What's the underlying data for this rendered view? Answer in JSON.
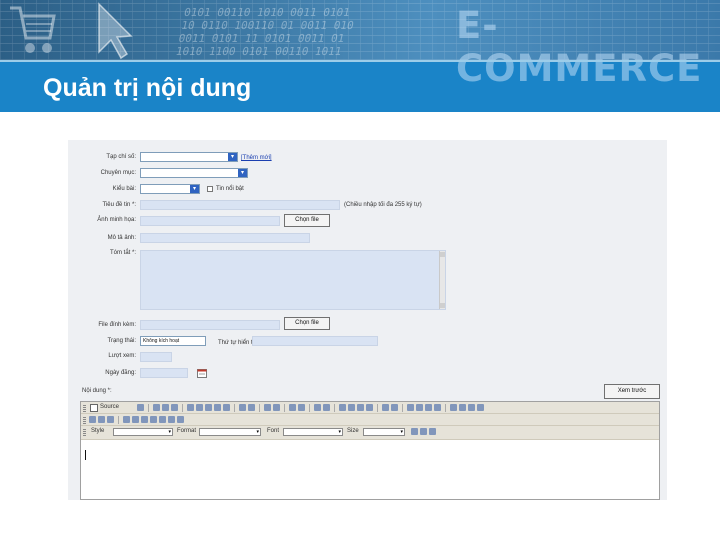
{
  "banner": {
    "brand_text": "E-COMMERCE",
    "digits": "0101 00110 1010 0011 0101\n10 0110 100110 01 0011 010\n0011 0101 11 0101 0011 01\n1010 1100 0101 00110 1011"
  },
  "slide": {
    "title": "Quản trị nội dung"
  },
  "form": {
    "labels": [
      "Tạp chí số:",
      "Chuyên mục:",
      "Kiểu bài:",
      "Tiêu đề tin *:",
      "Ảnh minh họa:",
      "Mô tả ảnh:",
      "Tóm tắt *:",
      "File đính kèm:",
      "Trạng thái:",
      "Lượt xem:",
      "Ngày đăng:",
      "Nội dung *:"
    ],
    "add_new_link": "[Thêm mới]",
    "featured_label": "Tin nổi bật",
    "title_hint": "(Chiều nhập tối đa 255 ký tự)",
    "choose_file": "Chọn file",
    "status_value": "Không kích hoạt",
    "order_label": "Thứ tự hiển thị:",
    "preview_button": "Xem trước"
  },
  "editor": {
    "source_label": "Source",
    "style_label": "Style",
    "format_label": "Format",
    "font_label": "Font",
    "size_label": "Size"
  },
  "colors": {
    "banner_blue": "#1a84c8",
    "input_fill": "#d9e3f3",
    "select_button": "#2f63c1"
  }
}
